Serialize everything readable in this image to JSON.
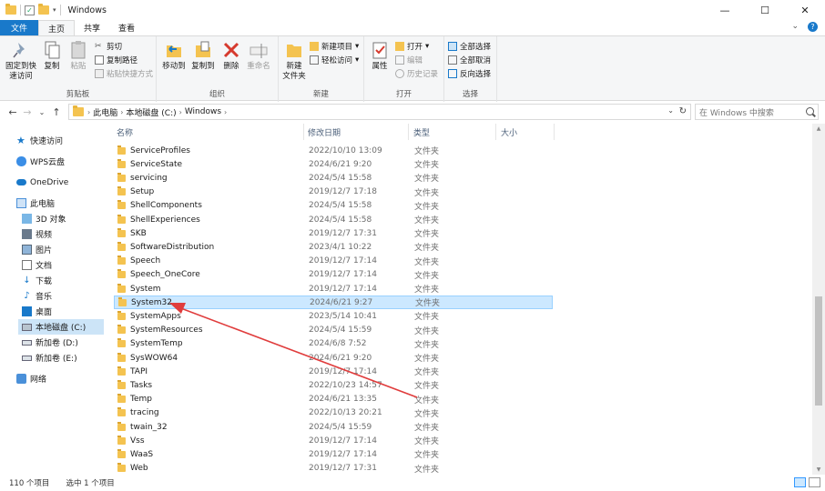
{
  "window": {
    "title": "Windows",
    "minimize": "—",
    "maximize": "☐",
    "close": "✕"
  },
  "tabs": {
    "file": "文件",
    "home": "主页",
    "share": "共享",
    "view": "查看"
  },
  "ribbon": {
    "clipboard": {
      "label": "剪贴板",
      "pin": "固定到快\n速访问",
      "copy": "复制",
      "paste": "粘贴",
      "cut": "剪切",
      "copy_path": "复制路径",
      "paste_shortcut": "粘贴快捷方式"
    },
    "organize": {
      "label": "组织",
      "move_to": "移动到",
      "copy_to": "复制到",
      "delete": "删除",
      "rename": "重命名"
    },
    "new": {
      "label": "新建",
      "new_folder": "新建\n文件夹",
      "new_item": "新建项目",
      "easy_access": "轻松访问"
    },
    "open": {
      "label": "打开",
      "properties": "属性",
      "open": "打开",
      "edit": "编辑",
      "history": "历史记录"
    },
    "select": {
      "label": "选择",
      "select_all": "全部选择",
      "select_none": "全部取消",
      "invert": "反向选择"
    }
  },
  "address": {
    "crumbs": [
      "此电脑",
      "本地磁盘 (C:)",
      "Windows"
    ],
    "search_placeholder": "在 Windows 中搜索"
  },
  "nav": {
    "quick_access": "快速访问",
    "wps": "WPS云盘",
    "onedrive": "OneDrive",
    "this_pc": "此电脑",
    "objects3d": "3D 对象",
    "videos": "视频",
    "pictures": "图片",
    "documents": "文档",
    "downloads": "下载",
    "music": "音乐",
    "desktop": "桌面",
    "local_c": "本地磁盘 (C:)",
    "vol_d": "新加卷 (D:)",
    "vol_e": "新加卷 (E:)",
    "network": "网络"
  },
  "columns": {
    "name": "名称",
    "date": "修改日期",
    "type": "类型",
    "size": "大小"
  },
  "files": [
    {
      "name": "ServiceProfiles",
      "date": "2022/10/10 13:09",
      "type": "文件夹"
    },
    {
      "name": "ServiceState",
      "date": "2024/6/21 9:20",
      "type": "文件夹"
    },
    {
      "name": "servicing",
      "date": "2024/5/4 15:58",
      "type": "文件夹"
    },
    {
      "name": "Setup",
      "date": "2019/12/7 17:18",
      "type": "文件夹"
    },
    {
      "name": "ShellComponents",
      "date": "2024/5/4 15:58",
      "type": "文件夹"
    },
    {
      "name": "ShellExperiences",
      "date": "2024/5/4 15:58",
      "type": "文件夹"
    },
    {
      "name": "SKB",
      "date": "2019/12/7 17:31",
      "type": "文件夹"
    },
    {
      "name": "SoftwareDistribution",
      "date": "2023/4/1 10:22",
      "type": "文件夹"
    },
    {
      "name": "Speech",
      "date": "2019/12/7 17:14",
      "type": "文件夹"
    },
    {
      "name": "Speech_OneCore",
      "date": "2019/12/7 17:14",
      "type": "文件夹"
    },
    {
      "name": "System",
      "date": "2019/12/7 17:14",
      "type": "文件夹"
    },
    {
      "name": "System32",
      "date": "2024/6/21 9:27",
      "type": "文件夹"
    },
    {
      "name": "SystemApps",
      "date": "2023/5/14 10:41",
      "type": "文件夹"
    },
    {
      "name": "SystemResources",
      "date": "2024/5/4 15:59",
      "type": "文件夹"
    },
    {
      "name": "SystemTemp",
      "date": "2024/6/8 7:52",
      "type": "文件夹"
    },
    {
      "name": "SysWOW64",
      "date": "2024/6/21 9:20",
      "type": "文件夹"
    },
    {
      "name": "TAPI",
      "date": "2019/12/7 17:14",
      "type": "文件夹"
    },
    {
      "name": "Tasks",
      "date": "2022/10/23 14:57",
      "type": "文件夹"
    },
    {
      "name": "Temp",
      "date": "2024/6/21 13:35",
      "type": "文件夹"
    },
    {
      "name": "tracing",
      "date": "2022/10/13 20:21",
      "type": "文件夹"
    },
    {
      "name": "twain_32",
      "date": "2024/5/4 15:59",
      "type": "文件夹"
    },
    {
      "name": "Vss",
      "date": "2019/12/7 17:14",
      "type": "文件夹"
    },
    {
      "name": "WaaS",
      "date": "2019/12/7 17:14",
      "type": "文件夹"
    },
    {
      "name": "Web",
      "date": "2019/12/7 17:31",
      "type": "文件夹"
    }
  ],
  "status": {
    "count": "110 个项目",
    "selected": "选中 1 个项目"
  },
  "colors": {
    "accent": "#1979ca",
    "selection": "#cce8ff",
    "folder": "#f4c350",
    "arrow": "#e03c3c"
  }
}
